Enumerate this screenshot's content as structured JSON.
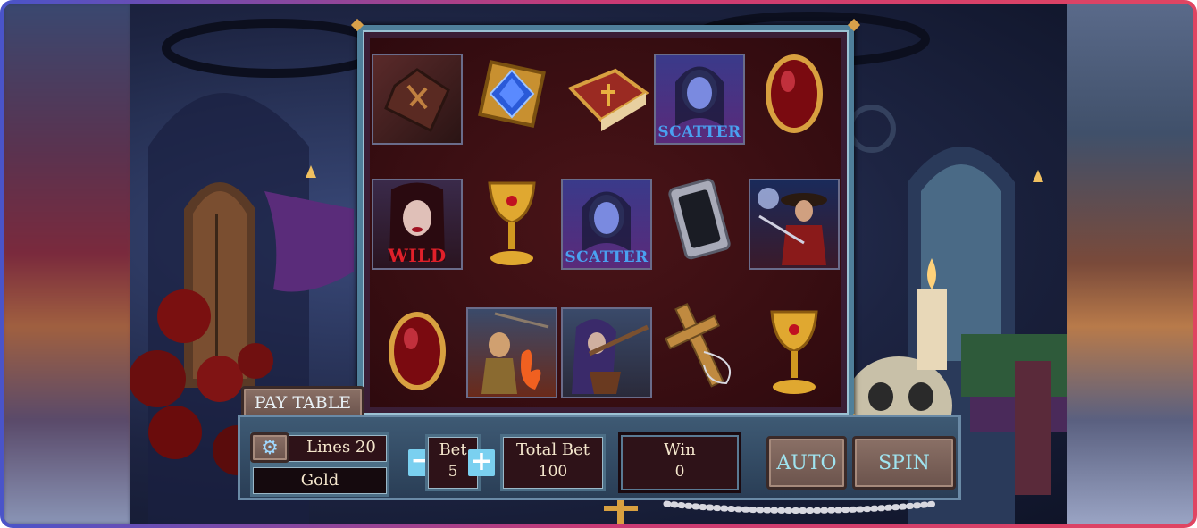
{
  "game": {
    "paytable_label": "PAY TABLE",
    "lines_label": "Lines 20",
    "gold_label": "Gold",
    "bet_label": "Bet",
    "bet_value": "5",
    "total_bet_label": "Total Bet",
    "total_bet_value": "100",
    "win_label": "Win",
    "win_value": "0",
    "auto_label": "AUTO",
    "spin_label": "SPIN",
    "minus_glyph": "−",
    "plus_glyph": "+",
    "gear_glyph": "⚙"
  },
  "reels": {
    "row1": [
      "coffin",
      "blue-gem",
      "spellbook",
      "scatter-vampiress",
      "red-amulet"
    ],
    "row2": [
      "wild-vampire",
      "golden-chalice",
      "scatter-vampiress",
      "silver-mirror",
      "vampire-hunter"
    ],
    "row3": [
      "red-amulet",
      "torch-villager",
      "crossbow-hunter",
      "wooden-cross",
      "golden-chalice"
    ],
    "scatter_text": "SCATTER",
    "wild_text": "WILD"
  },
  "colors": {
    "accent_cyan": "#9fe3ef",
    "panel_bg": "#2e1218",
    "reel_bg": "#3b0e12",
    "gold": "#d8a04a"
  }
}
